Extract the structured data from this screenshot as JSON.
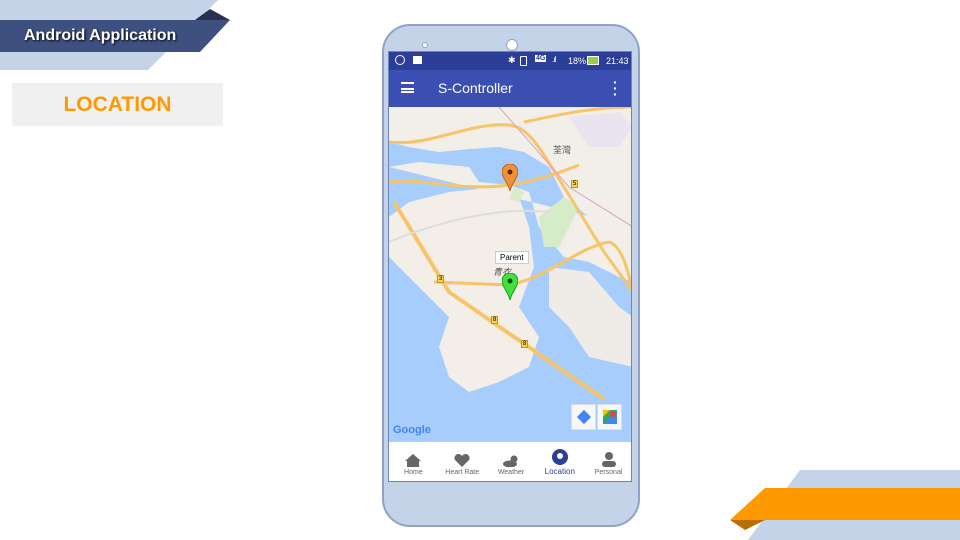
{
  "header": {
    "title": "Android Application",
    "section": "LOCATION"
  },
  "colors": {
    "brand_dark": "#3d5080",
    "brand_light": "#c5d3e8",
    "accent": "#ff9900",
    "appbar": "#3b4fb3",
    "statusbar": "#2d3e98"
  },
  "status": {
    "battery": "18%",
    "time": "21:43",
    "network": "4G"
  },
  "app": {
    "title": "S-Controller",
    "menu_icon": "hamburger-icon",
    "more_icon": "more-vert-icon"
  },
  "map": {
    "marker_label": "Parent",
    "district_1": "荃灣",
    "district_2": "青衣",
    "routes": [
      "3",
      "5",
      "8",
      "8"
    ],
    "attribution": "Google"
  },
  "nav": [
    {
      "label": "Home",
      "icon": "home-icon"
    },
    {
      "label": "Heart Rate",
      "icon": "heart-rate-icon"
    },
    {
      "label": "Weather",
      "icon": "weather-icon"
    },
    {
      "label": "Location",
      "icon": "location-icon",
      "active": true
    },
    {
      "label": "Personal",
      "icon": "person-icon"
    }
  ]
}
